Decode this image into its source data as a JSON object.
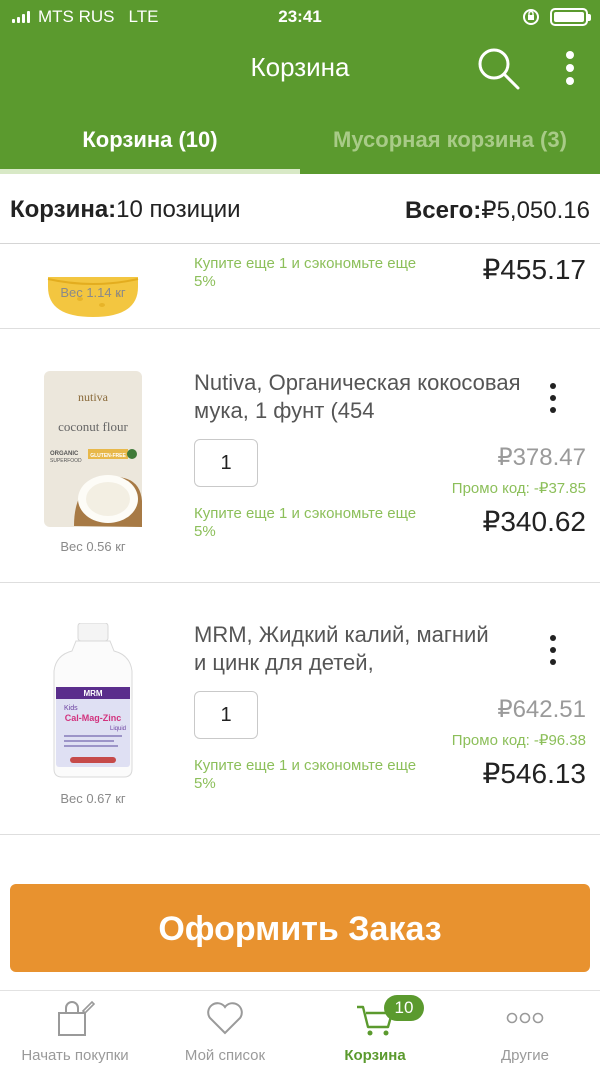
{
  "status_bar": {
    "carrier": "MTS RUS",
    "network": "LTE",
    "time": "23:41"
  },
  "header": {
    "title": "Корзина"
  },
  "tabs": [
    {
      "label": "Корзина (10)",
      "active": true
    },
    {
      "label": "Мусорная корзина (3)",
      "active": false
    }
  ],
  "summary": {
    "cart_label": "Корзина:",
    "cart_value": "10 позиции",
    "total_label": "Всего:",
    "total_value": "₽5,050.16"
  },
  "items": [
    {
      "weight": "Вес 1.14 кг",
      "deal": "Купите еще 1 и сэкономьте еще 5%",
      "price": "₽455.17"
    },
    {
      "name": "Nutiva, Органическая кокосовая мука, 1 фунт (454",
      "quantity": "1",
      "original_price": "₽378.47",
      "promo": "Промо код: -₽37.85",
      "deal": "Купите еще 1 и сэкономьте еще 5%",
      "price": "₽340.62",
      "weight": "Вес 0.56 кг",
      "package_text": {
        "brand": "nutiva",
        "product": "coconut flour",
        "line1": "ORGANIC",
        "line2": "SUPERFOOD",
        "tag": "GLUTEN-FREE"
      }
    },
    {
      "name": "MRM, Жидкий калий, магний и цинк для детей,",
      "quantity": "1",
      "original_price": "₽642.51",
      "promo": "Промо код: -₽96.38",
      "deal": "Купите еще 1 и сэкономьте еще 5%",
      "price": "₽546.13",
      "weight": "Вес 0.67 кг",
      "label_text": {
        "brand": "MRM",
        "kids": "Kids",
        "product": "Cal-Mag-Zinc",
        "form": "Liquid"
      }
    }
  ],
  "checkout": {
    "label": "Оформить Заказ"
  },
  "bottom_nav": [
    {
      "label": "Начать покупки",
      "icon": "shopping-bag-icon"
    },
    {
      "label": "Мой список",
      "icon": "heart-icon"
    },
    {
      "label": "Корзина",
      "icon": "cart-icon",
      "badge": "10",
      "active": true
    },
    {
      "label": "Другие",
      "icon": "more-dots-icon"
    }
  ],
  "colors": {
    "brand_green": "#5b9a2e",
    "accent_orange": "#e8922f",
    "promo_green": "#8cbf5a"
  }
}
